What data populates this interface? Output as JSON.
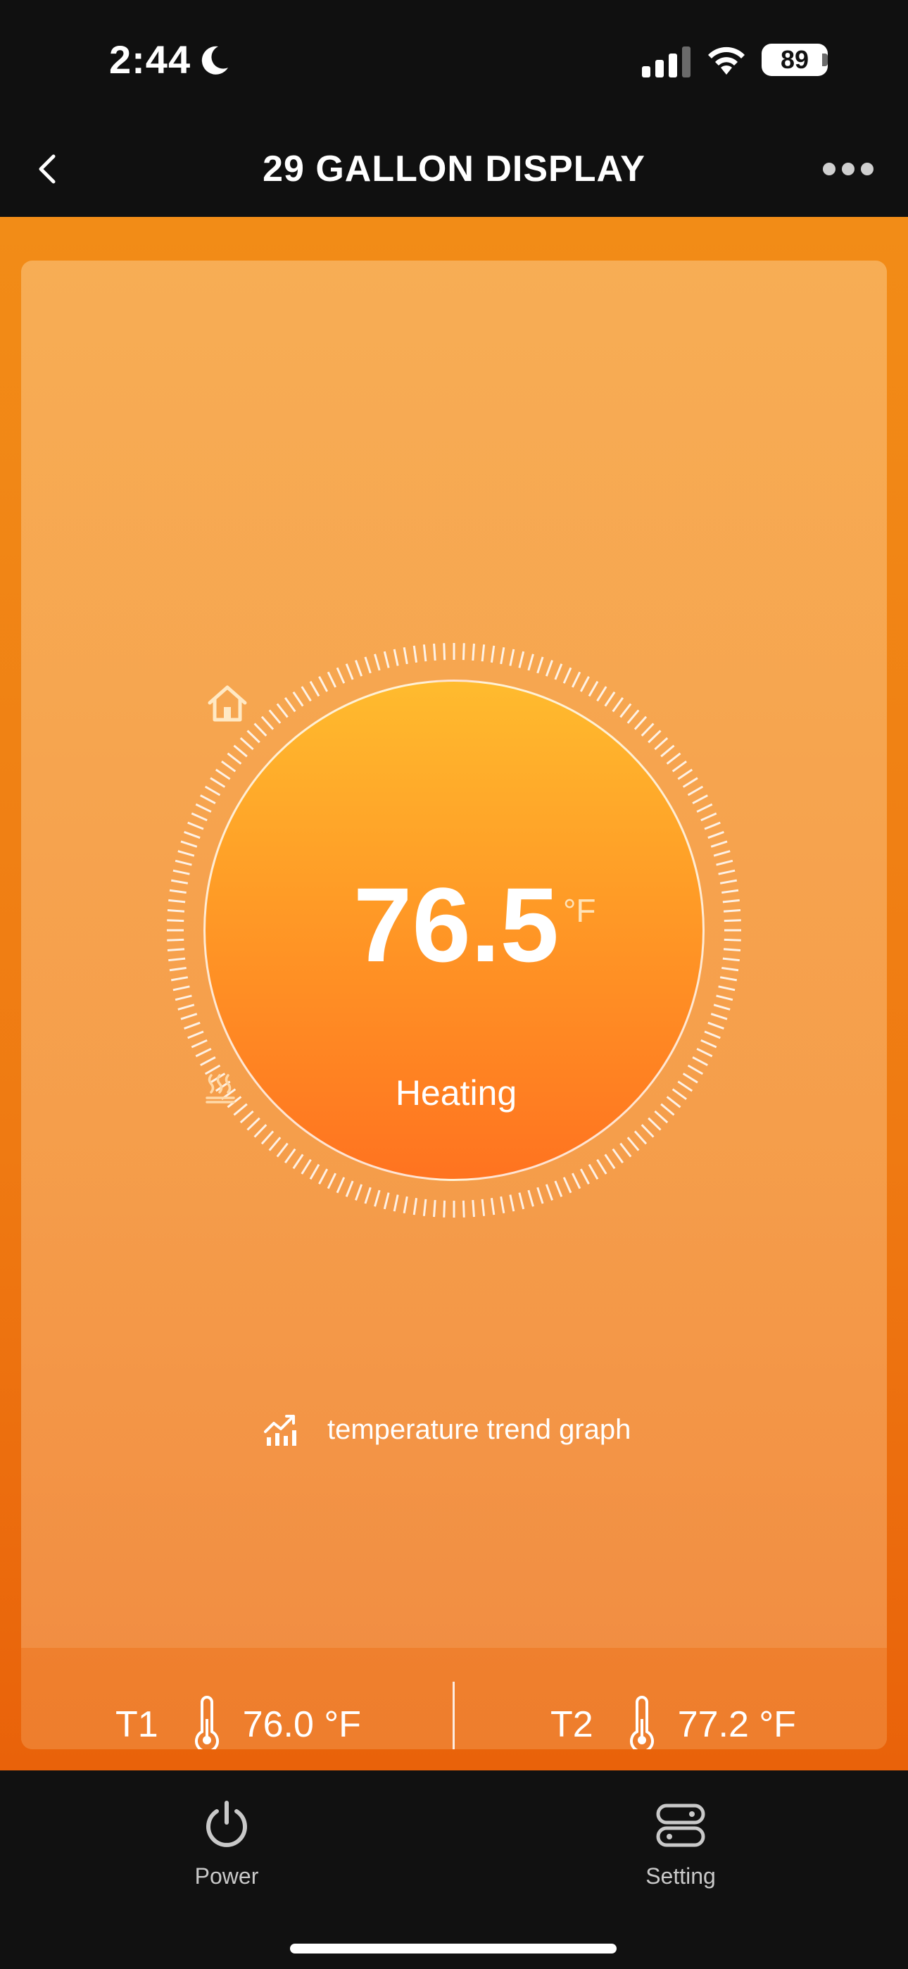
{
  "status_bar": {
    "time": "2:44",
    "battery_level": "89"
  },
  "header": {
    "title": "29 GALLON DISPLAY"
  },
  "thermostat": {
    "temperature": "76.5",
    "unit": "°F",
    "mode": "Heating"
  },
  "trend": {
    "label": "temperature trend graph"
  },
  "probes": [
    {
      "name": "T1",
      "value": "76.0 °F"
    },
    {
      "name": "T2",
      "value": "77.2 °F"
    }
  ],
  "tab_bar": {
    "items": [
      {
        "label": "Power"
      },
      {
        "label": "Setting"
      }
    ]
  },
  "colors": {
    "background": "#101010",
    "accent_orange": "#f28c17",
    "dial_top": "#ffbb2e",
    "dial_bottom": "#ff7320"
  }
}
